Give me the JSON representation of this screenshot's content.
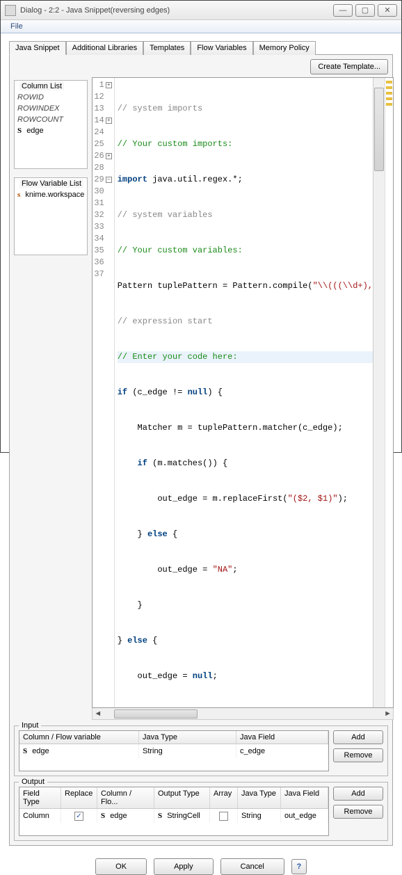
{
  "window": {
    "title": "Dialog - 2:2 - Java Snippet(reversing edges)"
  },
  "menu": {
    "file": "File"
  },
  "tabs": {
    "t0": "Java Snippet",
    "t1": "Additional Libraries",
    "t2": "Templates",
    "t3": "Flow Variables",
    "t4": "Memory Policy"
  },
  "buttons": {
    "create_template": "Create Template...",
    "add": "Add",
    "remove": "Remove",
    "ok": "OK",
    "apply": "Apply",
    "cancel": "Cancel"
  },
  "column_list": {
    "legend": "Column List",
    "items": {
      "i0": "ROWID",
      "i1": "ROWINDEX",
      "i2": "ROWCOUNT",
      "i3": "edge"
    }
  },
  "flowvar_list": {
    "legend": "Flow Variable List",
    "items": {
      "i0": "knime.workspace"
    }
  },
  "code": {
    "l1": "// system imports",
    "l12": "// Your custom imports:",
    "l13a": "import",
    "l13b": " java.util.regex.*;",
    "l14": "// system variables",
    "l24": "// Your custom variables:",
    "l25a": "Pattern tuplePattern = Pattern.compile(",
    "l25b": "\"\\\\(((\\\\d+),",
    "l26": "// expression start",
    "l28": "// Enter your code here:",
    "l29a": "if",
    "l29b": " (c_edge != ",
    "l29c": "null",
    "l29d": ") {",
    "l30": "    Matcher m = tuplePattern.matcher(c_edge);",
    "l31a": "    ",
    "l31b": "if",
    "l31c": " (m.matches()) {",
    "l32a": "        out_edge = m.replaceFirst(",
    "l32b": "\"($2, $1)\"",
    "l32c": ");",
    "l33a": "    } ",
    "l33b": "else",
    "l33c": " {",
    "l34a": "        out_edge = ",
    "l34b": "\"NA\"",
    "l34c": ";",
    "l35": "    }",
    "l36a": "} ",
    "l36b": "else",
    "l36c": " {",
    "l37a": "    out_edge = ",
    "l37b": "null",
    "l37c": ";"
  },
  "gutter": {
    "n1": "1",
    "n12": "12",
    "n13": "13",
    "n14": "14",
    "n24": "24",
    "n25": "25",
    "n26": "26",
    "n28": "28",
    "n29": "29",
    "n30": "30",
    "n31": "31",
    "n32": "32",
    "n33": "33",
    "n34": "34",
    "n35": "35",
    "n36": "36",
    "n37": "37"
  },
  "input": {
    "legend": "Input",
    "headers": {
      "h0": "Column / Flow variable",
      "h1": "Java Type",
      "h2": "Java Field"
    },
    "row": {
      "c0": "edge",
      "c1": "String",
      "c2": "c_edge"
    }
  },
  "output": {
    "legend": "Output",
    "headers": {
      "h0": "Field Type",
      "h1": "Replace",
      "h2": "Column / Flo...",
      "h3": "Output Type",
      "h4": "Array",
      "h5": "Java Type",
      "h6": "Java Field"
    },
    "row": {
      "c0": "Column",
      "c2": "edge",
      "c3": "StringCell",
      "c5": "String",
      "c6": "out_edge"
    }
  }
}
